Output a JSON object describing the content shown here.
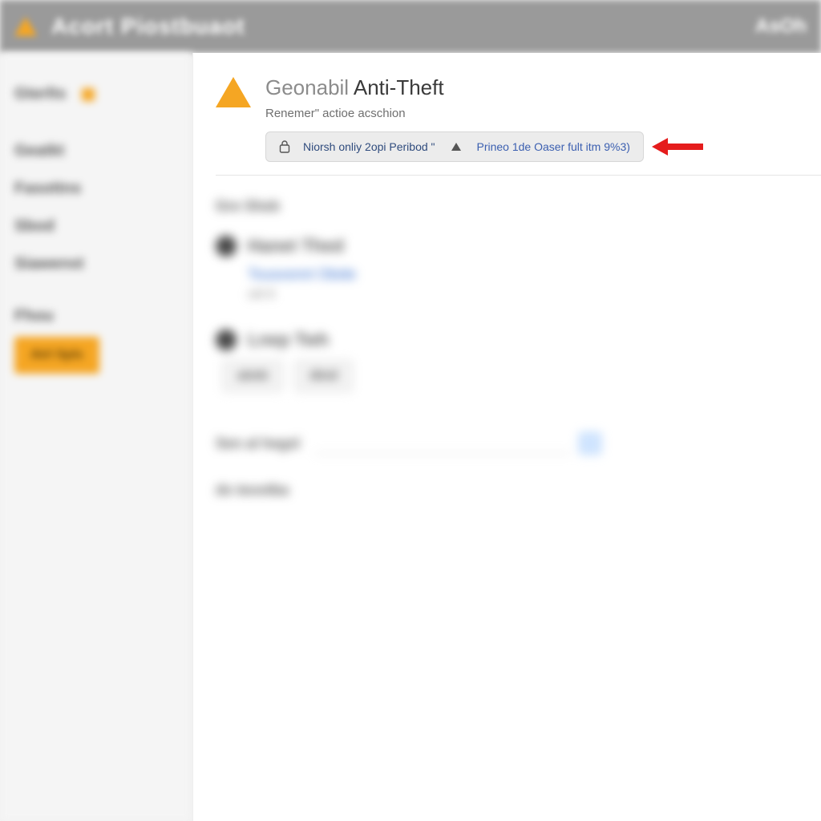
{
  "header": {
    "title": "Acort Piostbuaot",
    "right": "AsOh"
  },
  "sidebar": {
    "items": [
      {
        "label": "Gterlts",
        "active": true
      },
      {
        "label": "Geatkt"
      },
      {
        "label": "Fasottns"
      },
      {
        "label": "Sbod"
      },
      {
        "label": "Siawenst"
      }
    ],
    "section": "Fhou",
    "cta": "Atrl Spls"
  },
  "page": {
    "title_light": "Geonabil",
    "title_strong": "Anti-Theft",
    "subtitle": "Renemer\" actioe acschion"
  },
  "banner": {
    "seg1": "Niorsh onliy 2opi Peribod \"",
    "seg2": "Prineo 1de Oaser fult itm 9%3)"
  },
  "content": {
    "section1": "Gre Sheb",
    "device1": "Hanet Thed",
    "device1_meta": "Tousosnnt   Obide",
    "device1_sub": "otil 8",
    "device2": "Lnep  Twh",
    "btn1": "atmb",
    "btn2": "dtnd",
    "input_label": "Sen  al hegsl",
    "footer_label": "ds  teootba"
  },
  "colors": {
    "accent": "#f5a623",
    "header_bg": "#9a9a9a",
    "arrow": "#e51c1c",
    "banner_text": "#2f4b7d",
    "banner_link": "#3b5fb0"
  }
}
